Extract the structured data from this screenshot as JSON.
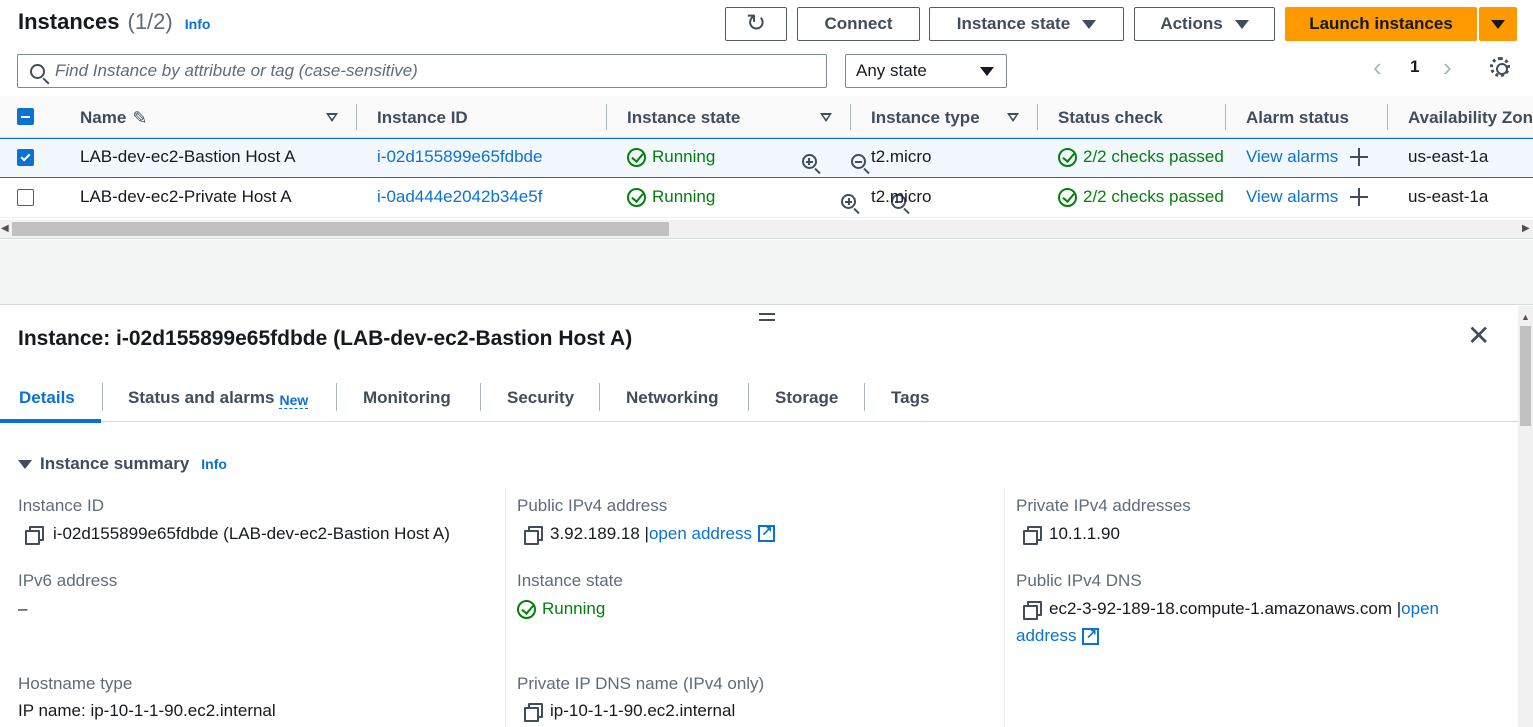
{
  "header": {
    "title": "Instances",
    "count": "(1/2)",
    "info": "Info",
    "buttons": {
      "connect": "Connect",
      "instance_state": "Instance state",
      "actions": "Actions",
      "launch": "Launch instances"
    }
  },
  "filter": {
    "search_placeholder": "Find Instance by attribute or tag (case-sensitive)",
    "state_select": "Any state",
    "page": "1"
  },
  "table": {
    "columns": [
      "Name",
      "Instance ID",
      "Instance state",
      "Instance type",
      "Status check",
      "Alarm status",
      "Availability Zone"
    ],
    "rows": [
      {
        "selected": true,
        "name": "LAB-dev-ec2-Bastion Host A",
        "id": "i-02d155899e65fdbde",
        "state": "Running",
        "type": "t2.micro",
        "status": "2/2 checks passed",
        "alarm": "View alarms",
        "az": "us-east-1a"
      },
      {
        "selected": false,
        "name": "LAB-dev-ec2-Private Host A",
        "id": "i-0ad444e2042b34e5f",
        "state": "Running",
        "type": "t2.micro",
        "status": "2/2 checks passed",
        "alarm": "View alarms",
        "az": "us-east-1a"
      }
    ]
  },
  "detail": {
    "title": "Instance: i-02d155899e65fdbde (LAB-dev-ec2-Bastion Host A)",
    "tabs": {
      "details": "Details",
      "status": "Status and alarms",
      "status_badge": "New",
      "monitoring": "Monitoring",
      "security": "Security",
      "networking": "Networking",
      "storage": "Storage",
      "tags": "Tags"
    },
    "section_title": "Instance summary",
    "section_info": "Info",
    "fields": {
      "instance_id_label": "Instance ID",
      "instance_id_value": "i-02d155899e65fdbde (LAB-dev-ec2-Bastion Host A)",
      "public_ipv4_label": "Public IPv4 address",
      "public_ipv4_value": "3.92.189.18",
      "open_address": "open address",
      "private_ipv4_label": "Private IPv4 addresses",
      "private_ipv4_value": "10.1.1.90",
      "ipv6_label": "IPv6 address",
      "ipv6_value": "–",
      "state_label": "Instance state",
      "state_value": "Running",
      "public_dns_label": "Public IPv4 DNS",
      "public_dns_value": "ec2-3-92-189-18.compute-1.amazonaws.com",
      "open_part1": "open",
      "open_part2": "address",
      "hostname_label": "Hostname type",
      "hostname_value": "IP name: ip-10-1-1-90.ec2.internal",
      "private_dns_label": "Private IP DNS name (IPv4 only)",
      "private_dns_value": "ip-10-1-1-90.ec2.internal"
    }
  },
  "colors": {
    "link": "#0972d3",
    "success": "#037f0c",
    "launch": "#ff9900",
    "selected_row": "#f2f8fd"
  }
}
